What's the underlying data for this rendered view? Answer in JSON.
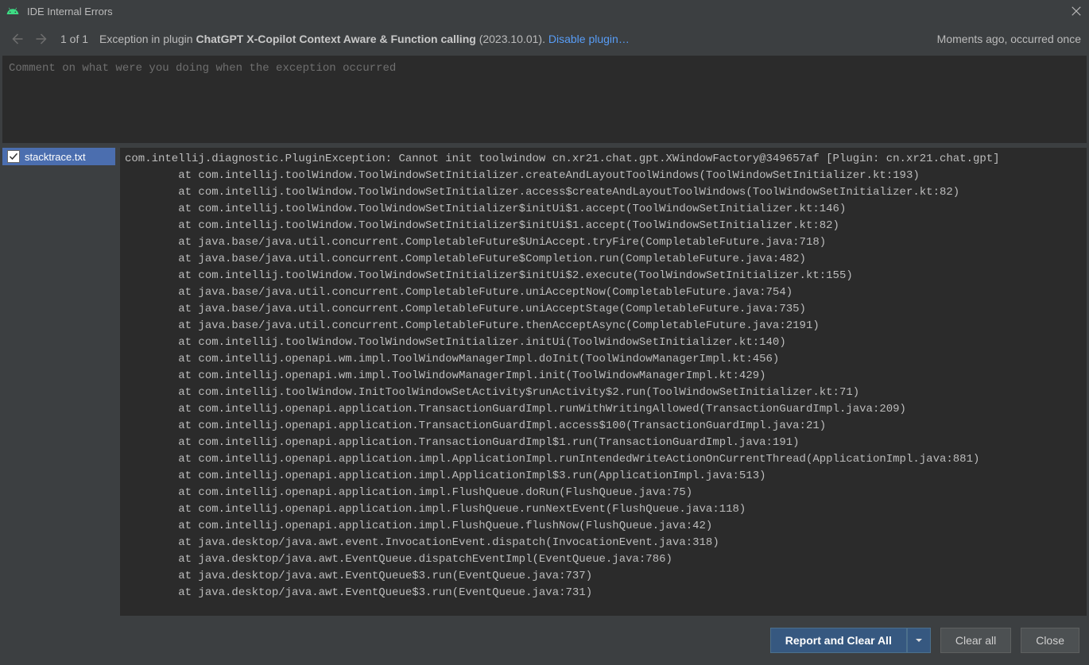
{
  "titlebar": {
    "title": "IDE Internal Errors"
  },
  "nav": {
    "counter": "1 of 1",
    "prefix": "Exception in plugin ",
    "plugin": "ChatGPT X-Copilot Context Aware & Function calling",
    "version": " (2023.10.01). ",
    "disable": "Disable plugin…",
    "time": "Moments ago, occurred once"
  },
  "comment": {
    "placeholder": "Comment on what were you doing when the exception occurred"
  },
  "attachments": {
    "item0": {
      "label": "stacktrace.txt"
    }
  },
  "stacktrace": "com.intellij.diagnostic.PluginException: Cannot init toolwindow cn.xr21.chat.gpt.XWindowFactory@349657af [Plugin: cn.xr21.chat.gpt]\n        at com.intellij.toolWindow.ToolWindowSetInitializer.createAndLayoutToolWindows(ToolWindowSetInitializer.kt:193)\n        at com.intellij.toolWindow.ToolWindowSetInitializer.access$createAndLayoutToolWindows(ToolWindowSetInitializer.kt:82)\n        at com.intellij.toolWindow.ToolWindowSetInitializer$initUi$1.accept(ToolWindowSetInitializer.kt:146)\n        at com.intellij.toolWindow.ToolWindowSetInitializer$initUi$1.accept(ToolWindowSetInitializer.kt:82)\n        at java.base/java.util.concurrent.CompletableFuture$UniAccept.tryFire(CompletableFuture.java:718)\n        at java.base/java.util.concurrent.CompletableFuture$Completion.run(CompletableFuture.java:482)\n        at com.intellij.toolWindow.ToolWindowSetInitializer$initUi$2.execute(ToolWindowSetInitializer.kt:155)\n        at java.base/java.util.concurrent.CompletableFuture.uniAcceptNow(CompletableFuture.java:754)\n        at java.base/java.util.concurrent.CompletableFuture.uniAcceptStage(CompletableFuture.java:735)\n        at java.base/java.util.concurrent.CompletableFuture.thenAcceptAsync(CompletableFuture.java:2191)\n        at com.intellij.toolWindow.ToolWindowSetInitializer.initUi(ToolWindowSetInitializer.kt:140)\n        at com.intellij.openapi.wm.impl.ToolWindowManagerImpl.doInit(ToolWindowManagerImpl.kt:456)\n        at com.intellij.openapi.wm.impl.ToolWindowManagerImpl.init(ToolWindowManagerImpl.kt:429)\n        at com.intellij.toolWindow.InitToolWindowSetActivity$runActivity$2.run(ToolWindowSetInitializer.kt:71)\n        at com.intellij.openapi.application.TransactionGuardImpl.runWithWritingAllowed(TransactionGuardImpl.java:209)\n        at com.intellij.openapi.application.TransactionGuardImpl.access$100(TransactionGuardImpl.java:21)\n        at com.intellij.openapi.application.TransactionGuardImpl$1.run(TransactionGuardImpl.java:191)\n        at com.intellij.openapi.application.impl.ApplicationImpl.runIntendedWriteActionOnCurrentThread(ApplicationImpl.java:881)\n        at com.intellij.openapi.application.impl.ApplicationImpl$3.run(ApplicationImpl.java:513)\n        at com.intellij.openapi.application.impl.FlushQueue.doRun(FlushQueue.java:75)\n        at com.intellij.openapi.application.impl.FlushQueue.runNextEvent(FlushQueue.java:118)\n        at com.intellij.openapi.application.impl.FlushQueue.flushNow(FlushQueue.java:42)\n        at java.desktop/java.awt.event.InvocationEvent.dispatch(InvocationEvent.java:318)\n        at java.desktop/java.awt.EventQueue.dispatchEventImpl(EventQueue.java:786)\n        at java.desktop/java.awt.EventQueue$3.run(EventQueue.java:737)\n        at java.desktop/java.awt.EventQueue$3.run(EventQueue.java:731)",
  "footer": {
    "report": "Report and Clear All",
    "clear": "Clear all",
    "close": "Close"
  }
}
